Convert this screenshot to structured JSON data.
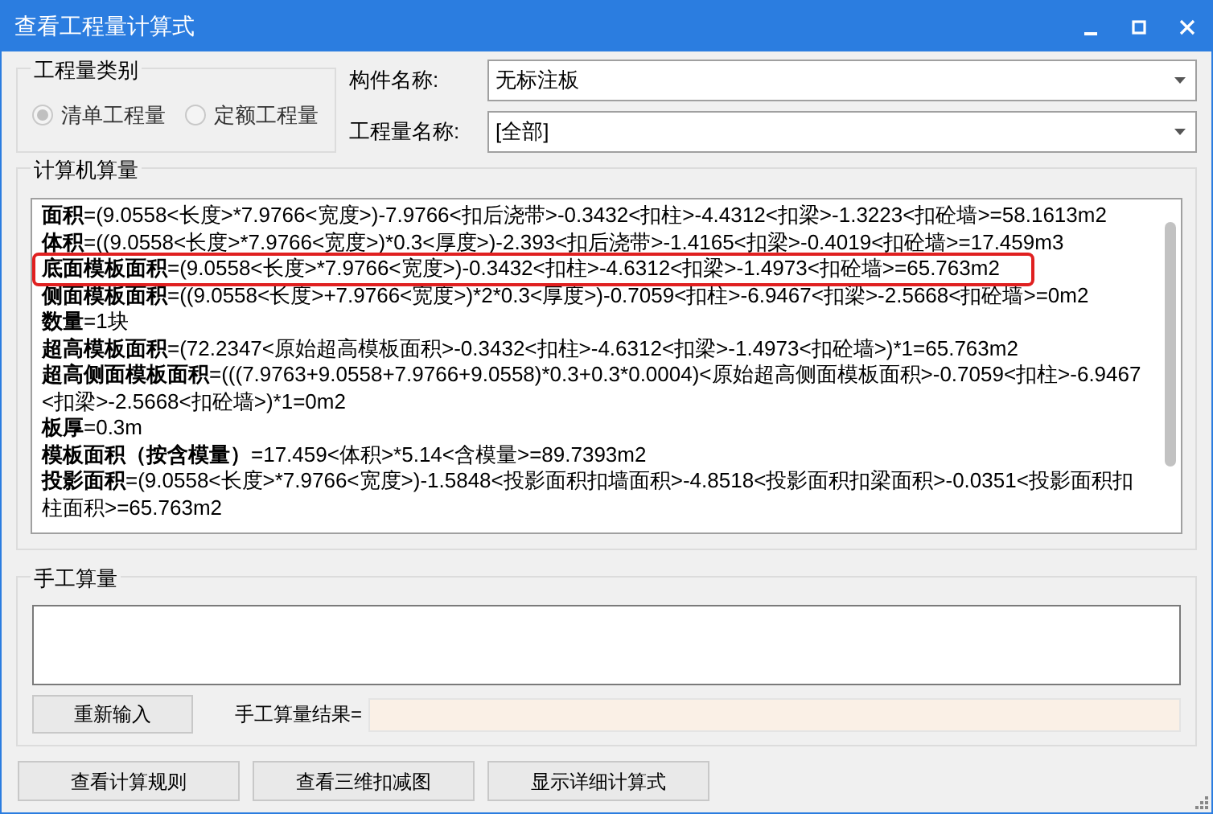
{
  "window": {
    "title": "查看工程量计算式"
  },
  "quantity_type": {
    "title": "工程量类别",
    "options": [
      {
        "label": "清单工程量",
        "selected": true,
        "disabled": true
      },
      {
        "label": "定额工程量",
        "selected": false,
        "disabled": true
      }
    ]
  },
  "fields": [
    {
      "label": "构件名称:",
      "value": "无标注板"
    },
    {
      "label": "工程量名称:",
      "value": "[全部]"
    }
  ],
  "computer_calc": {
    "title": "计算机算量",
    "lines": [
      {
        "text": "**面积**=(9.0558<长度>*7.9766<宽度>)-7.9766<扣后浇带>-0.3432<扣柱>-4.4312<扣梁>-1.3223<扣砼墙>=58.1613m2",
        "highlighted": false
      },
      {
        "text": "**体积**=((9.0558<长度>*7.9766<宽度>)*0.3<厚度>)-2.393<扣后浇带>-1.4165<扣梁>-0.4019<扣砼墙>=17.459m3",
        "highlighted": false
      },
      {
        "text": "**底面模板面积**=(9.0558<长度>*7.9766<宽度>)-0.3432<扣柱>-4.6312<扣梁>-1.4973<扣砼墙>=65.763m2",
        "highlighted": true
      },
      {
        "text": "**侧面模板面积**=((9.0558<长度>+7.9766<宽度>)*2*0.3<厚度>)-0.7059<扣柱>-6.9467<扣梁>-2.5668<扣砼墙>=0m2",
        "highlighted": false
      },
      {
        "text": "**数量**=1块",
        "highlighted": false
      },
      {
        "text": "**超高模板面积**=(72.2347<原始超高模板面积>-0.3432<扣柱>-4.6312<扣梁>-1.4973<扣砼墙>)*1=65.763m2",
        "highlighted": false
      },
      {
        "text": "**超高侧面模板面积**=(((7.9763+9.0558+7.9766+9.0558)*0.3+0.3*0.0004)<原始超高侧面模板面积>-0.7059<扣柱>-6.9467<扣梁>-2.5668<扣砼墙>)*1=0m2",
        "highlighted": false
      },
      {
        "text": "**板厚**=0.3m",
        "highlighted": false
      },
      {
        "text": "**模板面积（按含模量）**=17.459<体积>*5.14<含模量>=89.7393m2",
        "highlighted": false
      },
      {
        "text": "**投影面积**=(9.0558<长度>*7.9766<宽度>)-1.5848<投影面积扣墙面积>-4.8518<投影面积扣梁面积>-0.0351<投影面积扣柱面积>=65.763m2",
        "highlighted": false
      }
    ]
  },
  "manual_calc": {
    "title": "手工算量",
    "reset_button": "重新输入",
    "result_label": "手工算量结果="
  },
  "buttons": [
    "查看计算规则",
    "查看三维扣减图",
    "显示详细计算式"
  ]
}
